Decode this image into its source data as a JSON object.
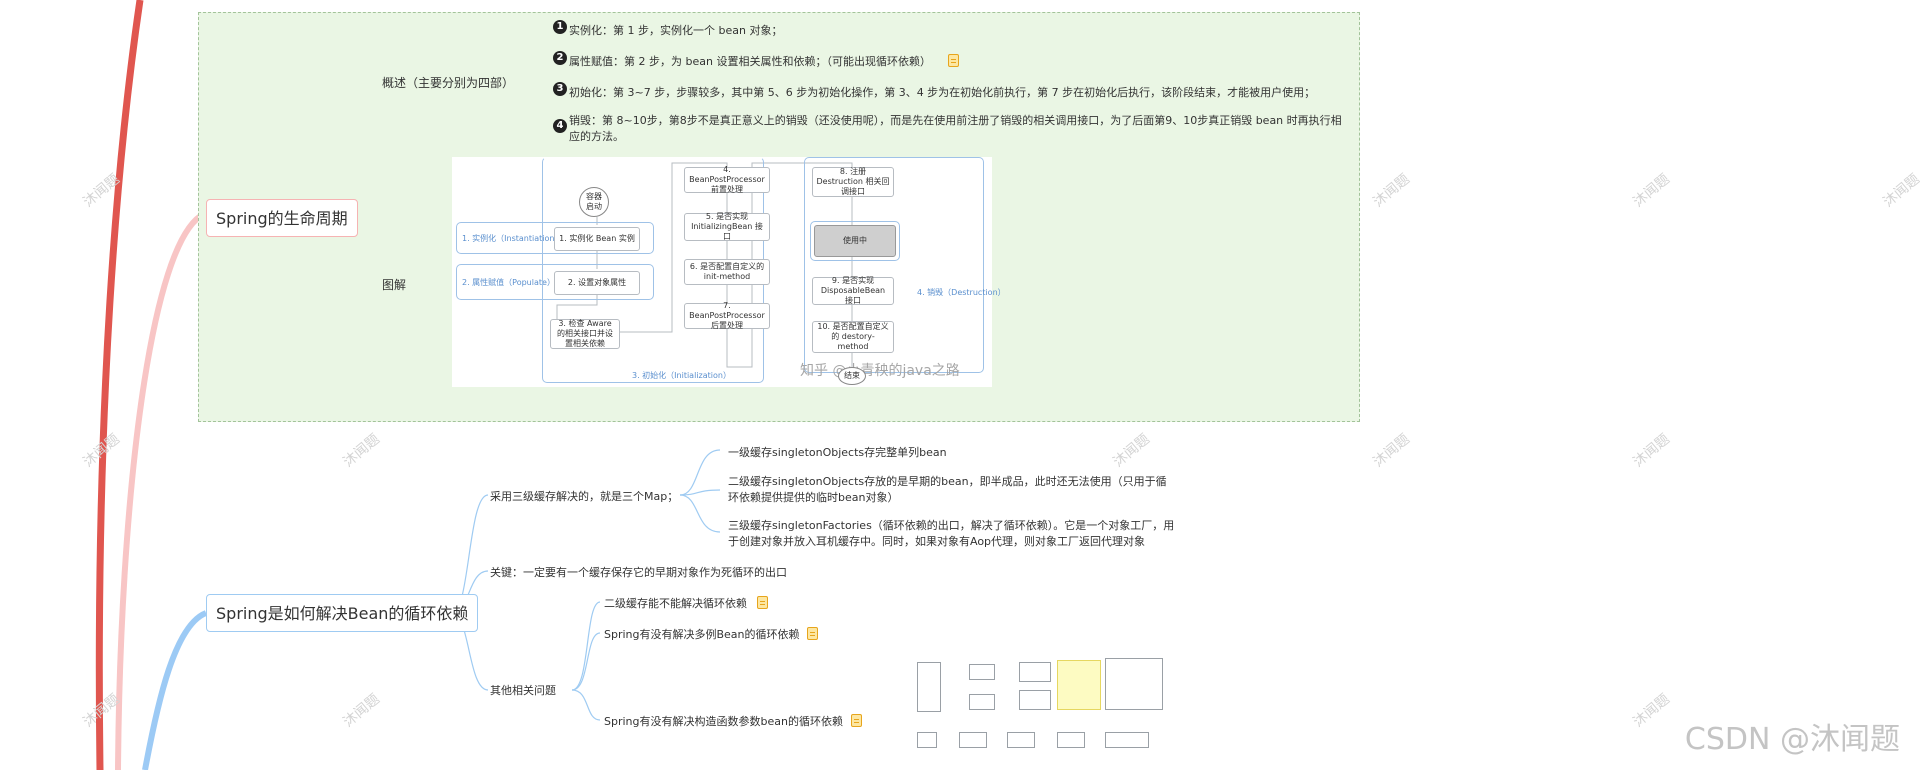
{
  "lifecycle": {
    "title": "Spring的生命周期",
    "overview_label": "概述（主要分别为四部）",
    "diagram_label": "图解",
    "steps": [
      {
        "num": "1",
        "text": "实例化：第 1 步，实例化一个 bean 对象；"
      },
      {
        "num": "2",
        "text": "属性赋值：第 2 步，为 bean 设置相关属性和依赖；（可能出现循环依赖）"
      },
      {
        "num": "3",
        "text": "初始化：第 3~7 步，步骤较多，其中第 5、6 步为初始化操作，第 3、4 步为在初始化前执行，第 7 步在初始化后执行，该阶段结束，才能被用户使用；"
      },
      {
        "num": "4",
        "text": "销毁：第 8~10步，第8步不是真正意义上的销毁（还没使用呢），而是先在使用前注册了销毁的相关调用接口，为了后面第9、10步真正销毁 bean 时再执行相应的方法。"
      }
    ]
  },
  "lifecycle_diagram": {
    "start": "容器\n启动",
    "end": "结束",
    "groups": {
      "instantiation": "1. 实例化（Instantiation）",
      "populate": "2. 属性赋值（Populate）",
      "initialization": "3. 初始化（Initialization）",
      "destruction": "4. 销毁（Destruction）"
    },
    "nodes": {
      "n1": "1. 实例化 Bean 实例",
      "n2": "2. 设置对象属性",
      "n3": "3. 检查 Aware 的相关接口并设置相关依赖",
      "n4": "4. BeanPostProcessor 前置处理",
      "n5": "5. 是否实现 InitializingBean 接口",
      "n6": "6. 是否配置自定义的 init-method",
      "n7": "7. BeanPostProcessor 后置处理",
      "n8": "8. 注册 Destruction 相关回调接口",
      "in_use": "使用中",
      "n9": "9. 是否实现 DisposableBean 接口",
      "n10": "10. 是否配置自定义的 destory-method"
    },
    "watermark": "知乎 @小青秧的java之路"
  },
  "circular": {
    "title": "Spring是如何解决Bean的循环依赖",
    "cache_label": "采用三级缓存解决的，就是三个Map；",
    "cache_items": [
      "一级缓存singletonObjects存完整单列bean",
      "二级缓存singletonObjects存放的是早期的bean，即半成品，此时还无法使用（只用于循环依赖提供提供的临时bean对象）",
      "三级缓存singletonFactories（循环依赖的出口，解决了循环依赖）。它是一个对象工厂，用于创建对象并放入耳机缓存中。同时，如果对象有Aop代理，则对象工厂返回代理对象"
    ],
    "key_label": "关键：一定要有一个缓存保存它的早期对象作为死循环的出口",
    "other_label": "其他相关问题",
    "other_items": [
      "二级缓存能不能解决循环依赖",
      "Spring有没有解决多例Bean的循环依赖",
      "Spring有没有解决构造函数参数bean的循环依赖"
    ]
  },
  "colors": {
    "red_branch": "#e0564f",
    "pink_branch": "#f8c5c5",
    "blue_branch": "#9ccaf5",
    "green_area": "#eaf6e4"
  },
  "watermark_text": "沐闻题",
  "csdn_mark": "CSDN @沐闻题"
}
